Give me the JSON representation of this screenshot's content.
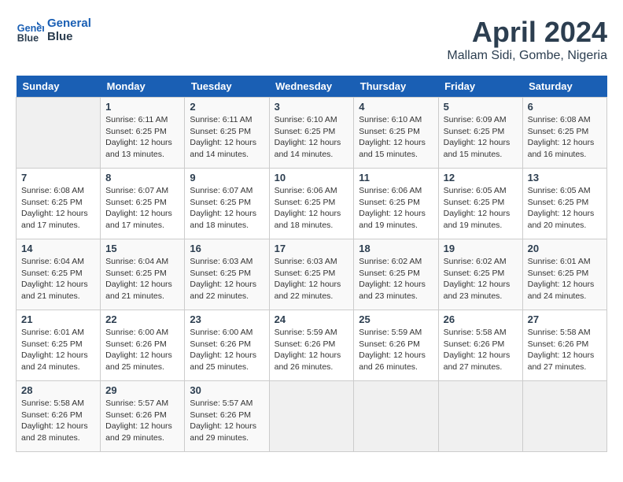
{
  "header": {
    "logo_line1": "General",
    "logo_line2": "Blue",
    "month": "April 2024",
    "location": "Mallam Sidi, Gombe, Nigeria"
  },
  "weekdays": [
    "Sunday",
    "Monday",
    "Tuesday",
    "Wednesday",
    "Thursday",
    "Friday",
    "Saturday"
  ],
  "weeks": [
    [
      {
        "day": "",
        "empty": true
      },
      {
        "day": "1",
        "sunrise": "6:11 AM",
        "sunset": "6:25 PM",
        "daylight": "12 hours and 13 minutes."
      },
      {
        "day": "2",
        "sunrise": "6:11 AM",
        "sunset": "6:25 PM",
        "daylight": "12 hours and 14 minutes."
      },
      {
        "day": "3",
        "sunrise": "6:10 AM",
        "sunset": "6:25 PM",
        "daylight": "12 hours and 14 minutes."
      },
      {
        "day": "4",
        "sunrise": "6:10 AM",
        "sunset": "6:25 PM",
        "daylight": "12 hours and 15 minutes."
      },
      {
        "day": "5",
        "sunrise": "6:09 AM",
        "sunset": "6:25 PM",
        "daylight": "12 hours and 15 minutes."
      },
      {
        "day": "6",
        "sunrise": "6:08 AM",
        "sunset": "6:25 PM",
        "daylight": "12 hours and 16 minutes."
      }
    ],
    [
      {
        "day": "7",
        "sunrise": "6:08 AM",
        "sunset": "6:25 PM",
        "daylight": "12 hours and 17 minutes."
      },
      {
        "day": "8",
        "sunrise": "6:07 AM",
        "sunset": "6:25 PM",
        "daylight": "12 hours and 17 minutes."
      },
      {
        "day": "9",
        "sunrise": "6:07 AM",
        "sunset": "6:25 PM",
        "daylight": "12 hours and 18 minutes."
      },
      {
        "day": "10",
        "sunrise": "6:06 AM",
        "sunset": "6:25 PM",
        "daylight": "12 hours and 18 minutes."
      },
      {
        "day": "11",
        "sunrise": "6:06 AM",
        "sunset": "6:25 PM",
        "daylight": "12 hours and 19 minutes."
      },
      {
        "day": "12",
        "sunrise": "6:05 AM",
        "sunset": "6:25 PM",
        "daylight": "12 hours and 19 minutes."
      },
      {
        "day": "13",
        "sunrise": "6:05 AM",
        "sunset": "6:25 PM",
        "daylight": "12 hours and 20 minutes."
      }
    ],
    [
      {
        "day": "14",
        "sunrise": "6:04 AM",
        "sunset": "6:25 PM",
        "daylight": "12 hours and 21 minutes."
      },
      {
        "day": "15",
        "sunrise": "6:04 AM",
        "sunset": "6:25 PM",
        "daylight": "12 hours and 21 minutes."
      },
      {
        "day": "16",
        "sunrise": "6:03 AM",
        "sunset": "6:25 PM",
        "daylight": "12 hours and 22 minutes."
      },
      {
        "day": "17",
        "sunrise": "6:03 AM",
        "sunset": "6:25 PM",
        "daylight": "12 hours and 22 minutes."
      },
      {
        "day": "18",
        "sunrise": "6:02 AM",
        "sunset": "6:25 PM",
        "daylight": "12 hours and 23 minutes."
      },
      {
        "day": "19",
        "sunrise": "6:02 AM",
        "sunset": "6:25 PM",
        "daylight": "12 hours and 23 minutes."
      },
      {
        "day": "20",
        "sunrise": "6:01 AM",
        "sunset": "6:25 PM",
        "daylight": "12 hours and 24 minutes."
      }
    ],
    [
      {
        "day": "21",
        "sunrise": "6:01 AM",
        "sunset": "6:25 PM",
        "daylight": "12 hours and 24 minutes."
      },
      {
        "day": "22",
        "sunrise": "6:00 AM",
        "sunset": "6:26 PM",
        "daylight": "12 hours and 25 minutes."
      },
      {
        "day": "23",
        "sunrise": "6:00 AM",
        "sunset": "6:26 PM",
        "daylight": "12 hours and 25 minutes."
      },
      {
        "day": "24",
        "sunrise": "5:59 AM",
        "sunset": "6:26 PM",
        "daylight": "12 hours and 26 minutes."
      },
      {
        "day": "25",
        "sunrise": "5:59 AM",
        "sunset": "6:26 PM",
        "daylight": "12 hours and 26 minutes."
      },
      {
        "day": "26",
        "sunrise": "5:58 AM",
        "sunset": "6:26 PM",
        "daylight": "12 hours and 27 minutes."
      },
      {
        "day": "27",
        "sunrise": "5:58 AM",
        "sunset": "6:26 PM",
        "daylight": "12 hours and 27 minutes."
      }
    ],
    [
      {
        "day": "28",
        "sunrise": "5:58 AM",
        "sunset": "6:26 PM",
        "daylight": "12 hours and 28 minutes."
      },
      {
        "day": "29",
        "sunrise": "5:57 AM",
        "sunset": "6:26 PM",
        "daylight": "12 hours and 29 minutes."
      },
      {
        "day": "30",
        "sunrise": "5:57 AM",
        "sunset": "6:26 PM",
        "daylight": "12 hours and 29 minutes."
      },
      {
        "day": "",
        "empty": true
      },
      {
        "day": "",
        "empty": true
      },
      {
        "day": "",
        "empty": true
      },
      {
        "day": "",
        "empty": true
      }
    ]
  ],
  "labels": {
    "sunrise": "Sunrise:",
    "sunset": "Sunset:",
    "daylight": "Daylight:"
  }
}
